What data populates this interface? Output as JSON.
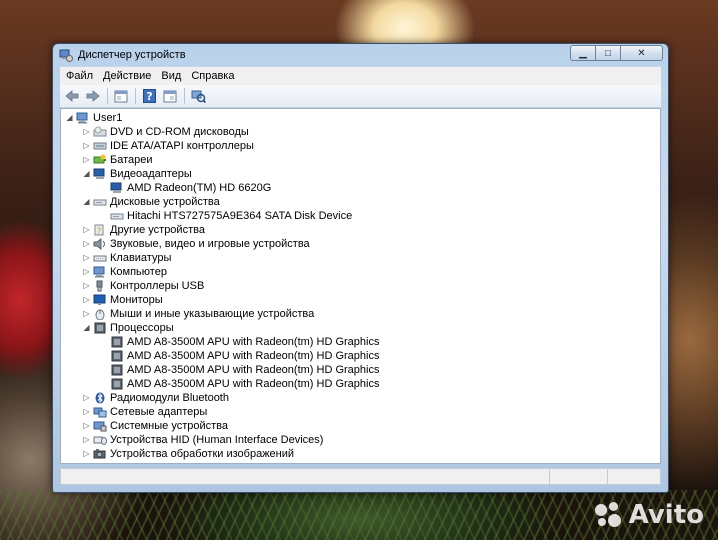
{
  "window": {
    "title": "Диспетчер устройств",
    "caption_buttons": {
      "minimize": "▁",
      "maximize": "□",
      "close": "✕"
    }
  },
  "menu": [
    "Файл",
    "Действие",
    "Вид",
    "Справка"
  ],
  "toolbar": [
    {
      "icon": "back-arrow-icon",
      "type": "button"
    },
    {
      "icon": "forward-arrow-icon",
      "type": "button"
    },
    {
      "type": "separator"
    },
    {
      "icon": "properties-icon",
      "type": "button"
    },
    {
      "type": "separator"
    },
    {
      "icon": "help-icon",
      "type": "button"
    },
    {
      "icon": "show-hidden-icon",
      "type": "button"
    },
    {
      "type": "separator"
    },
    {
      "icon": "scan-hardware-icon",
      "type": "button"
    }
  ],
  "tree": [
    {
      "label": "User1",
      "level": 0,
      "state": "expanded",
      "icon": "computer-icon"
    },
    {
      "label": "DVD и CD-ROM дисководы",
      "level": 1,
      "state": "collapsed",
      "icon": "dvd-drive-icon"
    },
    {
      "label": "IDE ATA/ATAPI контроллеры",
      "level": 1,
      "state": "collapsed",
      "icon": "ide-controller-icon"
    },
    {
      "label": "Батареи",
      "level": 1,
      "state": "collapsed",
      "icon": "battery-icon"
    },
    {
      "label": "Видеоадаптеры",
      "level": 1,
      "state": "expanded",
      "icon": "display-adapter-icon"
    },
    {
      "label": "AMD Radeon(TM) HD 6620G",
      "level": 2,
      "state": "leaf",
      "icon": "display-adapter-icon"
    },
    {
      "label": "Дисковые устройства",
      "level": 1,
      "state": "expanded",
      "icon": "disk-drive-icon"
    },
    {
      "label": "Hitachi HTS727575A9E364 SATA Disk Device",
      "level": 2,
      "state": "leaf",
      "icon": "disk-drive-icon"
    },
    {
      "label": "Другие устройства",
      "level": 1,
      "state": "collapsed",
      "icon": "other-devices-icon"
    },
    {
      "label": "Звуковые, видео и игровые устройства",
      "level": 1,
      "state": "collapsed",
      "icon": "sound-icon"
    },
    {
      "label": "Клавиатуры",
      "level": 1,
      "state": "collapsed",
      "icon": "keyboard-icon"
    },
    {
      "label": "Компьютер",
      "level": 1,
      "state": "collapsed",
      "icon": "computer-icon"
    },
    {
      "label": "Контроллеры USB",
      "level": 1,
      "state": "collapsed",
      "icon": "usb-icon"
    },
    {
      "label": "Мониторы",
      "level": 1,
      "state": "collapsed",
      "icon": "monitor-icon"
    },
    {
      "label": "Мыши и иные указывающие устройства",
      "level": 1,
      "state": "collapsed",
      "icon": "mouse-icon"
    },
    {
      "label": "Процессоры",
      "level": 1,
      "state": "expanded",
      "icon": "processor-icon"
    },
    {
      "label": "AMD A8-3500M APU with Radeon(tm) HD Graphics",
      "level": 2,
      "state": "leaf",
      "icon": "processor-icon"
    },
    {
      "label": "AMD A8-3500M APU with Radeon(tm) HD Graphics",
      "level": 2,
      "state": "leaf",
      "icon": "processor-icon"
    },
    {
      "label": "AMD A8-3500M APU with Radeon(tm) HD Graphics",
      "level": 2,
      "state": "leaf",
      "icon": "processor-icon"
    },
    {
      "label": "AMD A8-3500M APU with Radeon(tm) HD Graphics",
      "level": 2,
      "state": "leaf",
      "icon": "processor-icon"
    },
    {
      "label": "Радиомодули Bluetooth",
      "level": 1,
      "state": "collapsed",
      "icon": "bluetooth-icon"
    },
    {
      "label": "Сетевые адаптеры",
      "level": 1,
      "state": "collapsed",
      "icon": "network-adapter-icon"
    },
    {
      "label": "Системные устройства",
      "level": 1,
      "state": "collapsed",
      "icon": "system-devices-icon"
    },
    {
      "label": "Устройства HID (Human Interface Devices)",
      "level": 1,
      "state": "collapsed",
      "icon": "hid-icon"
    },
    {
      "label": "Устройства обработки изображений",
      "level": 1,
      "state": "collapsed",
      "icon": "imaging-device-icon"
    }
  ],
  "watermark": {
    "text": "Avito",
    "icon": "avito-logo-icon"
  },
  "colors": {
    "accent": "#2a5aa8",
    "titlebar": "#b9d1ea"
  }
}
